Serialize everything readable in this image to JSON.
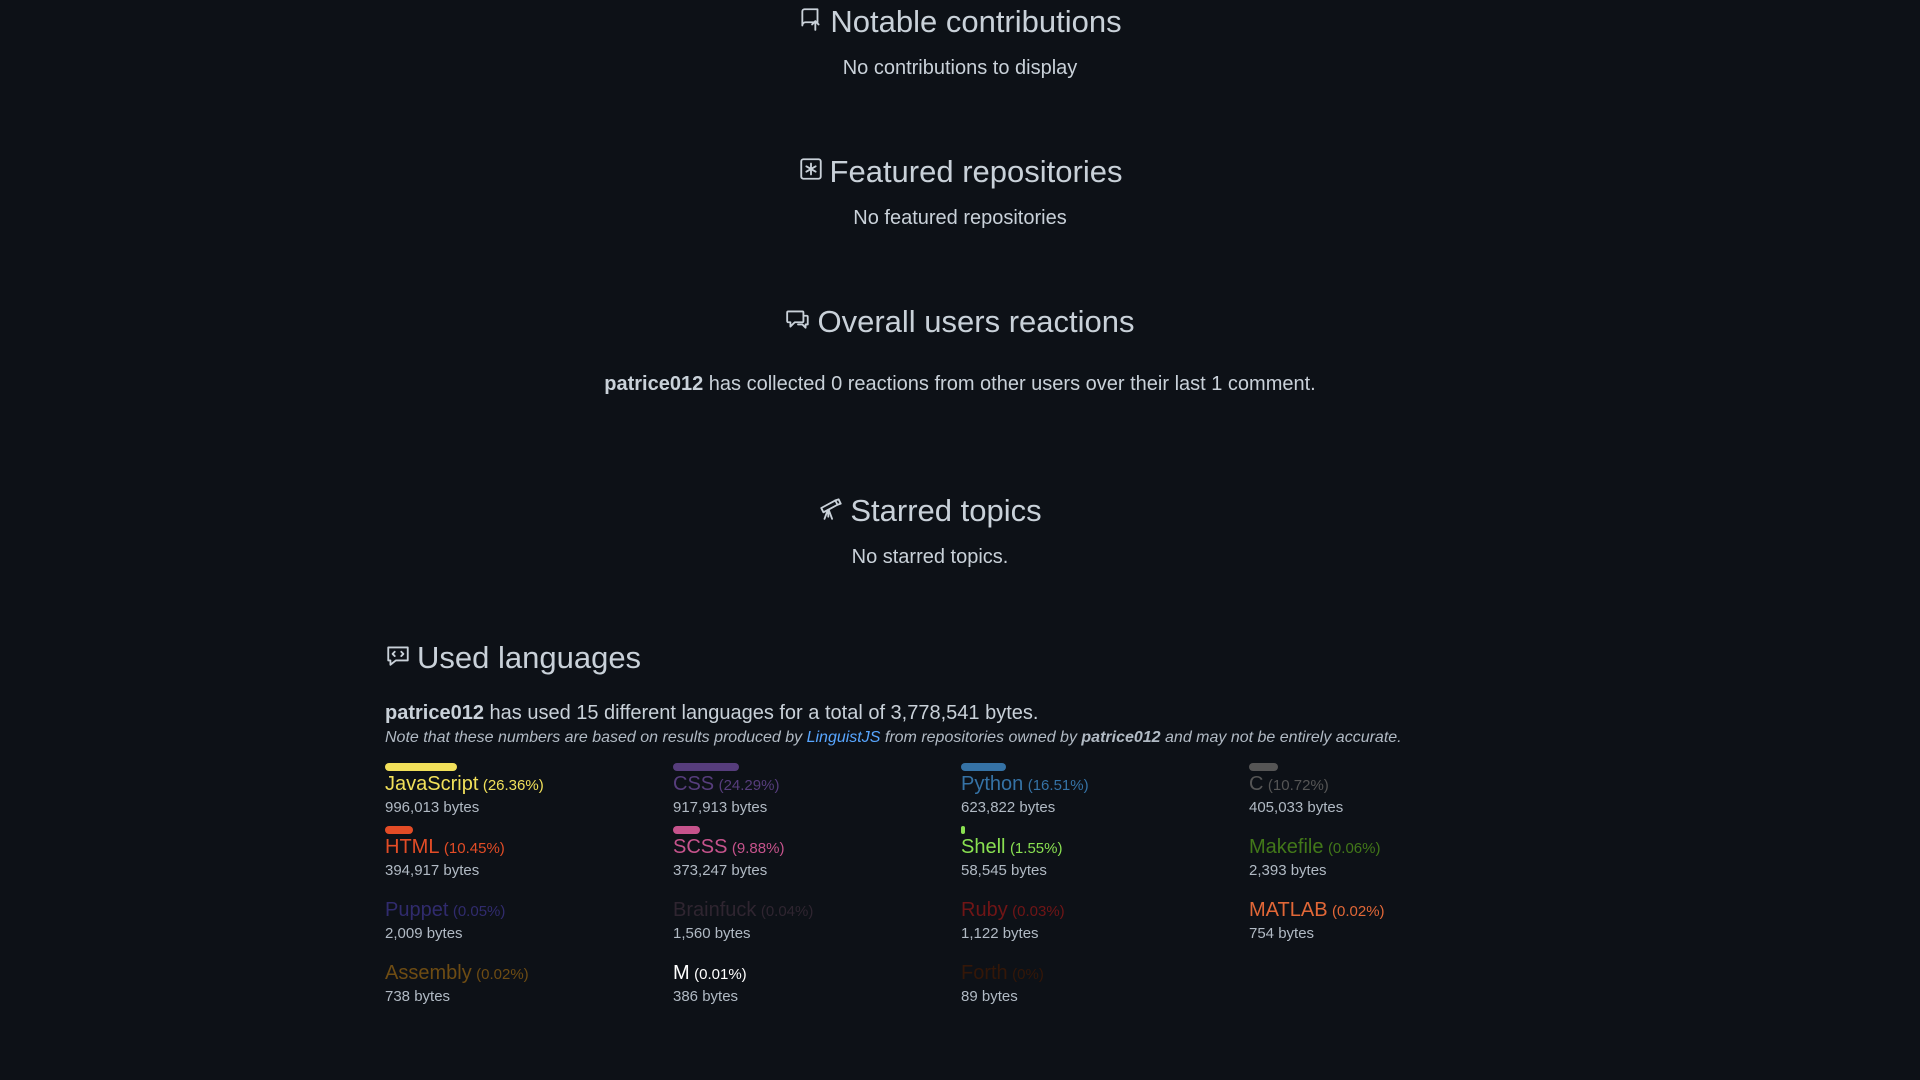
{
  "notable": {
    "title": "Notable contributions",
    "text": "No contributions to display"
  },
  "featured": {
    "title": "Featured repositories",
    "text": "No featured repositories"
  },
  "reactions": {
    "title": "Overall users reactions",
    "user": "patrice012",
    "text": " has collected 0 reactions from other users over their last 1 comment."
  },
  "starred": {
    "title": "Starred topics",
    "text": "No starred topics."
  },
  "languages": {
    "title": "Used languages",
    "user": "patrice012",
    "summary": " has used 15 different languages for a total of 3,778,541 bytes.",
    "note_prefix": "Note that these numbers are based on results produced by ",
    "note_link": "LinguistJS",
    "note_middle": " from repositories owned by ",
    "note_user": "patrice012",
    "note_suffix": " and may not be entirely accurate.",
    "items": [
      {
        "name": "JavaScript",
        "pct": "(26.36%)",
        "bytes": "996,013 bytes",
        "color": "#f1e05a",
        "bar": 0.2636
      },
      {
        "name": "CSS",
        "pct": "(24.29%)",
        "bytes": "917,913 bytes",
        "color": "#563d7c",
        "bar": 0.2429
      },
      {
        "name": "Python",
        "pct": "(16.51%)",
        "bytes": "623,822 bytes",
        "color": "#3572a5",
        "bar": 0.1651
      },
      {
        "name": "C",
        "pct": "(10.72%)",
        "bytes": "405,033 bytes",
        "color": "#555555",
        "bar": 0.1072
      },
      {
        "name": "HTML",
        "pct": "(10.45%)",
        "bytes": "394,917 bytes",
        "color": "#e34c26",
        "bar": 0.1045
      },
      {
        "name": "SCSS",
        "pct": "(9.88%)",
        "bytes": "373,247 bytes",
        "color": "#c6538c",
        "bar": 0.0988
      },
      {
        "name": "Shell",
        "pct": "(1.55%)",
        "bytes": "58,545 bytes",
        "color": "#89e051",
        "bar": 0.0155
      },
      {
        "name": "Makefile",
        "pct": "(0.06%)",
        "bytes": "2,393 bytes",
        "color": "#427819",
        "bar": 0.0006
      },
      {
        "name": "Puppet",
        "pct": "(0.05%)",
        "bytes": "2,009 bytes",
        "color": "#302b6d",
        "bar": 0.0005
      },
      {
        "name": "Brainfuck",
        "pct": "(0.04%)",
        "bytes": "1,560 bytes",
        "color": "#2f2530",
        "bar": 0.0004
      },
      {
        "name": "Ruby",
        "pct": "(0.03%)",
        "bytes": "1,122 bytes",
        "color": "#701516",
        "bar": 0.0003
      },
      {
        "name": "MATLAB",
        "pct": "(0.02%)",
        "bytes": "754 bytes",
        "color": "#e16737",
        "bar": 0.0002
      },
      {
        "name": "Assembly",
        "pct": "(0.02%)",
        "bytes": "738 bytes",
        "color": "#6e4c13",
        "bar": 0.0002
      },
      {
        "name": "M",
        "pct": "(0.01%)",
        "bytes": "386 bytes",
        "color": "#ffffff",
        "bar": 0.0001
      },
      {
        "name": "Forth",
        "pct": "(0%)",
        "bytes": "89 bytes",
        "color": "#341708",
        "bar": 0
      }
    ]
  }
}
